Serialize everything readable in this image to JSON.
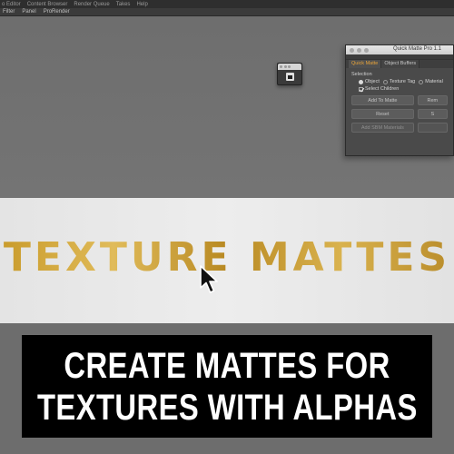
{
  "menubar": {
    "items": [
      "o Editor",
      "Content Browser",
      "Render Queue",
      "Takes",
      "Help"
    ]
  },
  "submenu": {
    "items": [
      "Filter",
      "Panel",
      "ProRender"
    ]
  },
  "quick_matte": {
    "title": "Quick Matte Pro 1.1",
    "tabs": [
      "Quick Matte",
      "Object Buffers"
    ],
    "selection_label": "Selection",
    "options": [
      "Object",
      "Texture Tag",
      "Material"
    ],
    "selected_option": "Object",
    "select_children_label": "Select Children",
    "select_children_checked": true,
    "buttons": {
      "add_to_matte": "Add To Matte",
      "add_side": "Rem",
      "reset": "Reset",
      "reset_side": "S",
      "add_sbm": "Add SBM Materials",
      "add_sbm_side": ""
    }
  },
  "texture_band": {
    "text": "TEXTURE MATTES"
  },
  "caption": {
    "line1": "CREATE MATTES FOR",
    "line2": "TEXTURES WITH ALPHAS"
  },
  "colors": {
    "accent_tab": "#e8a43a",
    "gold": "#c99b2b"
  }
}
